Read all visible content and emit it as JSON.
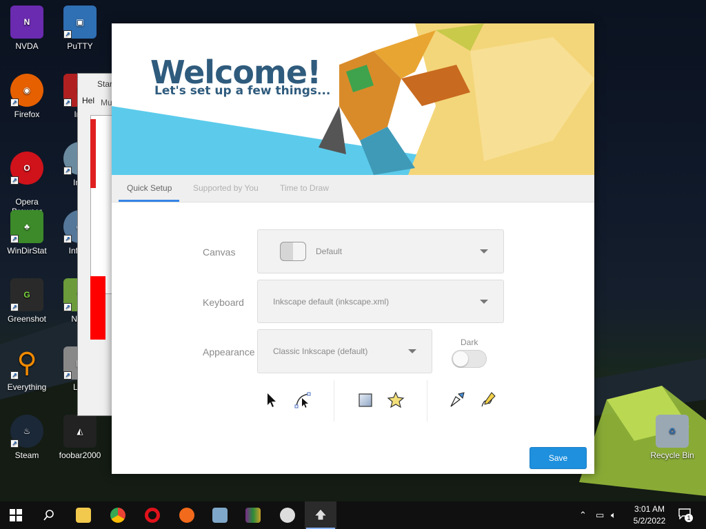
{
  "desktop": {
    "icons": [
      {
        "label": "NVDA",
        "color": "#6a2bb0"
      },
      {
        "label": "PuTTY",
        "color": "#2f6fb3"
      },
      {
        "label": "Firefox",
        "color": "#e66000"
      },
      {
        "label": "Irfa",
        "color": "#b02020"
      },
      {
        "label": "Opera\nBrowser",
        "color": "#d0121b"
      },
      {
        "label": "Img",
        "color": "#6a8aa0"
      },
      {
        "label": "WinDirStat",
        "color": "#3c8a2a"
      },
      {
        "label": "InfraR",
        "color": "#557799"
      },
      {
        "label": "Greenshot",
        "color": "#2a2a2a"
      },
      {
        "label": "Note",
        "color": "#6b9b3a"
      },
      {
        "label": "Everything",
        "color": "#f08a00"
      },
      {
        "label": "Lau",
        "color": "#888888"
      },
      {
        "label": "Steam",
        "color": "#1b2838"
      },
      {
        "label": "foobar2000",
        "color": "#222222"
      },
      {
        "label": "Recycle Bin",
        "color": "#9aa8b4"
      }
    ],
    "background_window": {
      "title": "Star",
      "menu": "Hel",
      "field": "Mu"
    }
  },
  "dialog": {
    "banner": {
      "welcome": "Welcome!",
      "subtitle": "Let's set up a few things..."
    },
    "tabs": [
      {
        "label": "Quick Setup",
        "active": true
      },
      {
        "label": "Supported by You",
        "active": false
      },
      {
        "label": "Time to Draw",
        "active": false
      }
    ],
    "canvas": {
      "label": "Canvas",
      "value": "Default"
    },
    "keyboard": {
      "label": "Keyboard",
      "value": "Inkscape default (inkscape.xml)"
    },
    "appearance": {
      "label": "Appearance",
      "value": "Classic Inkscape (default)"
    },
    "dark": {
      "label": "Dark",
      "enabled": false
    },
    "tool_icons": [
      "pointer-icon",
      "node-tool-icon",
      "rectangle-tool-icon",
      "star-tool-icon",
      "pen-tool-icon",
      "pencil-tool-icon"
    ],
    "save_label": "Save",
    "accent": "#1e90dd"
  },
  "taskbar": {
    "apps": [
      "start-icon",
      "search-icon",
      "file-explorer-icon",
      "chrome-icon",
      "opera-icon",
      "app-icon",
      "app-icon",
      "winrar-icon",
      "app-icon",
      "inkscape-icon"
    ],
    "time": "3:01 AM",
    "date": "5/2/2022",
    "notification_count": "1"
  }
}
